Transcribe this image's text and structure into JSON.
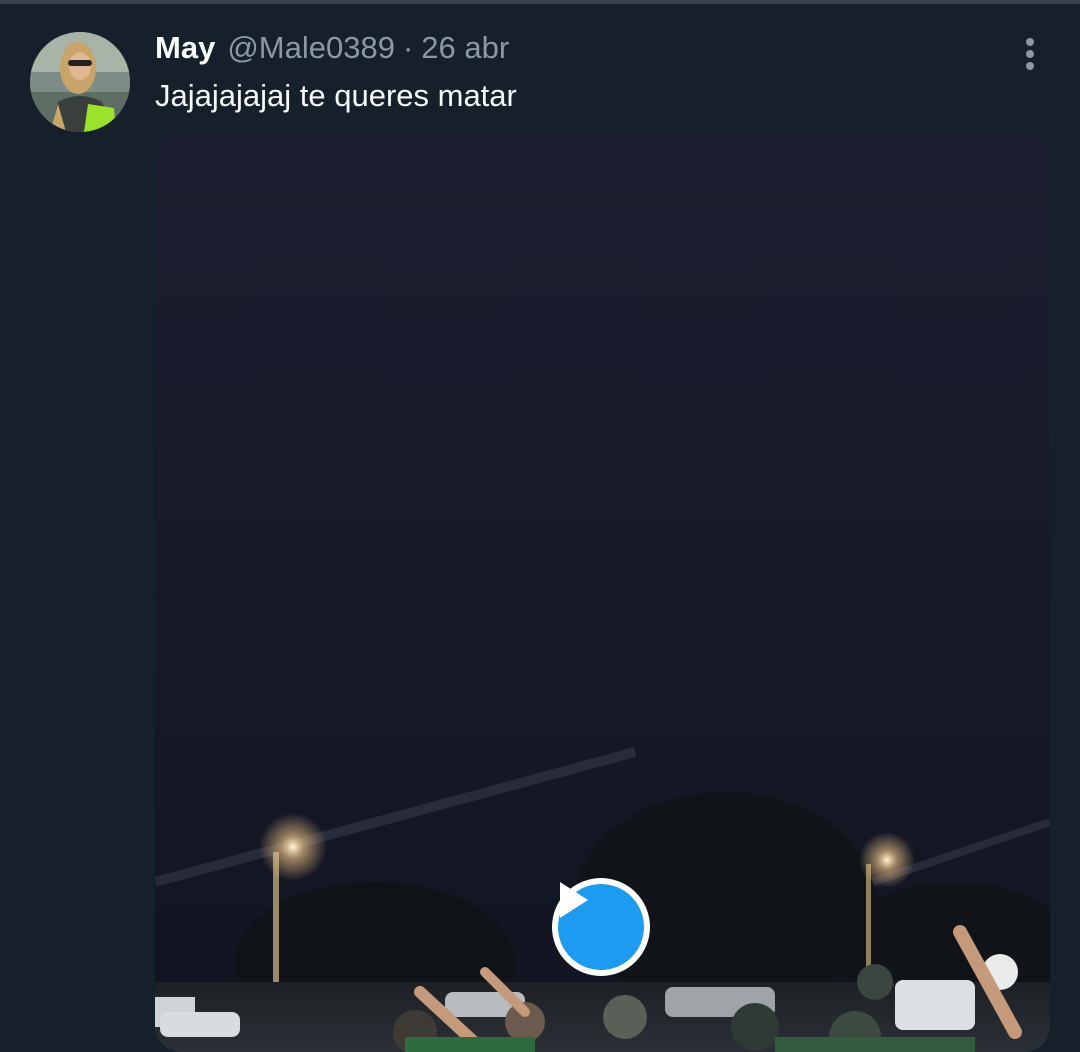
{
  "tweet": {
    "display_name": "May",
    "handle": "@Male0389",
    "separator": "·",
    "date": "26 abr",
    "text": "Jajajajajaj te queres matar"
  },
  "icons": {
    "more": "more-vertical-icon",
    "play": "play-icon"
  },
  "colors": {
    "background": "#15202b",
    "primary_text": "#f7f9f9",
    "secondary_text": "#8b98a5",
    "accent": "#1d9bf0"
  }
}
